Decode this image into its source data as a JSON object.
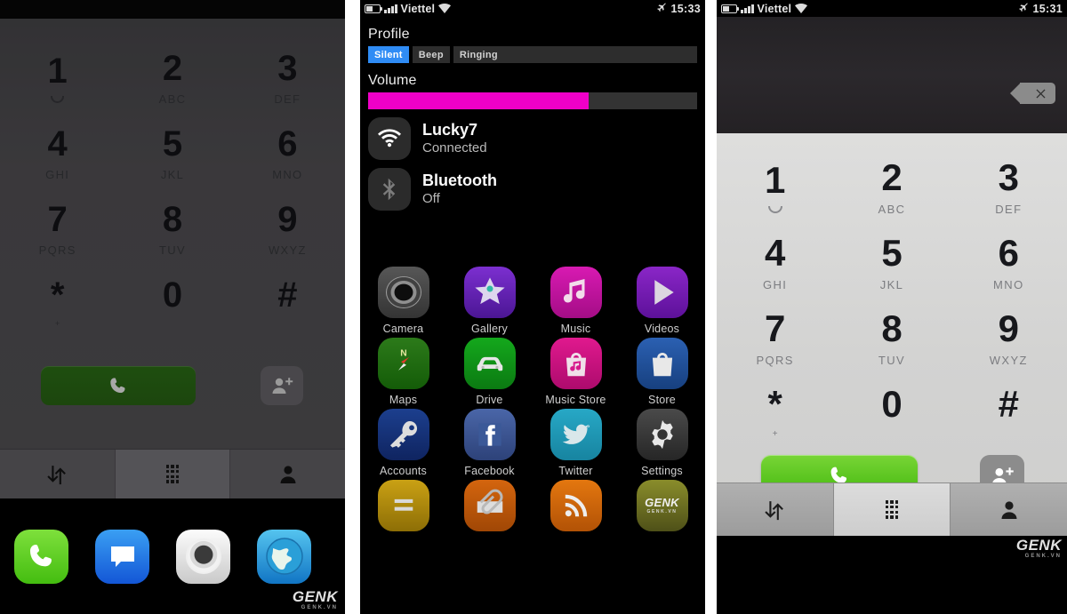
{
  "panels": {
    "left": {
      "name": "Dialer (dimmed) with home dock",
      "keypad": [
        {
          "digit": "1",
          "sub": "",
          "icon": "voicemail-icon"
        },
        {
          "digit": "2",
          "sub": "ABC",
          "icon": ""
        },
        {
          "digit": "3",
          "sub": "DEF",
          "icon": ""
        },
        {
          "digit": "4",
          "sub": "GHI",
          "icon": ""
        },
        {
          "digit": "5",
          "sub": "JKL",
          "icon": ""
        },
        {
          "digit": "6",
          "sub": "MNO",
          "icon": ""
        },
        {
          "digit": "7",
          "sub": "PQRS",
          "icon": ""
        },
        {
          "digit": "8",
          "sub": "TUV",
          "icon": ""
        },
        {
          "digit": "9",
          "sub": "WXYZ",
          "icon": ""
        },
        {
          "digit": "*",
          "sub": "+",
          "icon": ""
        },
        {
          "digit": "0",
          "sub": "",
          "icon": ""
        },
        {
          "digit": "#",
          "sub": "",
          "icon": ""
        }
      ],
      "call_button": "call-icon",
      "add_contact_button": "add-contact-icon",
      "tabs": [
        {
          "icon": "call-log-icon",
          "active": false
        },
        {
          "icon": "keypad-icon",
          "active": true
        },
        {
          "icon": "contacts-icon",
          "active": false
        }
      ],
      "dock": [
        {
          "label": "Phone",
          "icon": "phone-icon"
        },
        {
          "label": "Messages",
          "icon": "message-icon"
        },
        {
          "label": "Camera",
          "icon": "camera-icon"
        },
        {
          "label": "Browser",
          "icon": "globe-icon"
        }
      ],
      "watermark": "GENK",
      "watermark_sub": "GENK.VN"
    },
    "middle": {
      "status": {
        "battery": "battery-icon",
        "signal": "signal-bars-icon",
        "carrier": "Viettel",
        "wifi": "wifi-icon",
        "alert": "airplane-icon",
        "time": "15:33"
      },
      "profile": {
        "label": "Profile",
        "options": [
          {
            "label": "Silent",
            "selected": true
          },
          {
            "label": "Beep",
            "selected": false
          },
          {
            "label": "Ringing",
            "selected": false
          }
        ]
      },
      "volume": {
        "label": "Volume",
        "percent": 67
      },
      "toggles": [
        {
          "icon": "wifi-icon",
          "title": "Lucky7",
          "status": "Connected",
          "on": true
        },
        {
          "icon": "bluetooth-icon",
          "title": "Bluetooth",
          "status": "Off",
          "on": false
        }
      ],
      "apps": [
        {
          "label": "Camera",
          "icon": "camera-icon",
          "bg": "bg-camera"
        },
        {
          "label": "Gallery",
          "icon": "flower-icon",
          "bg": "bg-gallery"
        },
        {
          "label": "Music",
          "icon": "music-note-icon",
          "bg": "bg-music"
        },
        {
          "label": "Videos",
          "icon": "play-icon",
          "bg": "bg-videos"
        },
        {
          "label": "Maps",
          "icon": "compass-icon",
          "bg": "bg-maps"
        },
        {
          "label": "Drive",
          "icon": "car-icon",
          "bg": "bg-drive"
        },
        {
          "label": "Music Store",
          "icon": "music-bag-icon",
          "bg": "bg-mstore"
        },
        {
          "label": "Store",
          "icon": "bag-icon",
          "bg": "bg-store"
        },
        {
          "label": "Accounts",
          "icon": "key-icon",
          "bg": "bg-accounts"
        },
        {
          "label": "Facebook",
          "icon": "facebook-icon",
          "bg": "bg-facebook"
        },
        {
          "label": "Twitter",
          "icon": "twitter-bird-icon",
          "bg": "bg-twitter"
        },
        {
          "label": "Settings",
          "icon": "gear-icon",
          "bg": "bg-settings"
        },
        {
          "label": "",
          "icon": "notes-icon",
          "bg": "bg-notes"
        },
        {
          "label": "",
          "icon": "paperclip-icon",
          "bg": "bg-files"
        },
        {
          "label": "",
          "icon": "rss-icon",
          "bg": "bg-rss"
        },
        {
          "label": "",
          "icon": "genk-icon",
          "bg": "bg-genk"
        }
      ],
      "watermark": "GENK",
      "watermark_sub": "GENK.VN"
    },
    "right": {
      "status": {
        "battery": "battery-icon",
        "signal": "signal-bars-icon",
        "carrier": "Viettel",
        "wifi": "wifi-icon",
        "alert": "airplane-icon",
        "time": "15:31"
      },
      "number_field": "",
      "delete_button": "backspace-icon",
      "keypad": [
        {
          "digit": "1",
          "sub": "",
          "icon": "voicemail-icon"
        },
        {
          "digit": "2",
          "sub": "ABC",
          "icon": ""
        },
        {
          "digit": "3",
          "sub": "DEF",
          "icon": ""
        },
        {
          "digit": "4",
          "sub": "GHI",
          "icon": ""
        },
        {
          "digit": "5",
          "sub": "JKL",
          "icon": ""
        },
        {
          "digit": "6",
          "sub": "MNO",
          "icon": ""
        },
        {
          "digit": "7",
          "sub": "PQRS",
          "icon": ""
        },
        {
          "digit": "8",
          "sub": "TUV",
          "icon": ""
        },
        {
          "digit": "9",
          "sub": "WXYZ",
          "icon": ""
        },
        {
          "digit": "*",
          "sub": "+",
          "icon": ""
        },
        {
          "digit": "0",
          "sub": "",
          "icon": ""
        },
        {
          "digit": "#",
          "sub": "",
          "icon": ""
        }
      ],
      "call_button": "call-icon",
      "add_contact_button": "add-contact-icon",
      "tabs": [
        {
          "icon": "call-log-icon",
          "active": false
        },
        {
          "icon": "keypad-icon",
          "active": true
        },
        {
          "icon": "contacts-icon",
          "active": false
        }
      ],
      "watermark": "GENK",
      "watermark_sub": "GENK.VN"
    }
  },
  "colors": {
    "accent_blue": "#2f8cf5",
    "volume_magenta": "#ef00c8",
    "call_green": "#46b910",
    "panel_dark": "#000000",
    "keypad_light": "#d6d6d5"
  }
}
